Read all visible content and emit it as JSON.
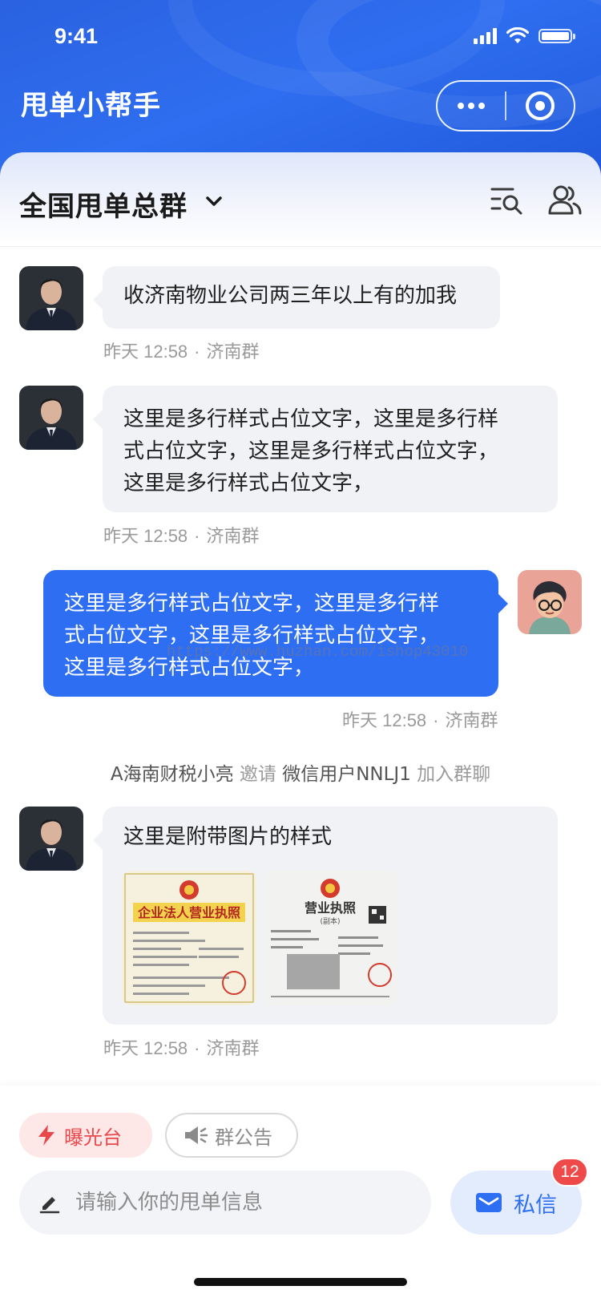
{
  "status_bar": {
    "time": "9:41"
  },
  "header": {
    "app_title": "甩单小帮手"
  },
  "group": {
    "name": "全国甩单总群"
  },
  "messages": [
    {
      "side": "left",
      "text": "收济南物业公司两三年以上有的加我",
      "time": "昨天 12:58",
      "group": "济南群"
    },
    {
      "side": "left",
      "lines": [
        "这里是多行样式占位文字，这里是多行样",
        "式占位文字，这里是多行样式占位文字，",
        "这里是多行样式占位文字，"
      ],
      "time": "昨天 12:58",
      "group": "济南群"
    },
    {
      "side": "right",
      "lines": [
        "这里是多行样式占位文字，这里是多行样",
        "式占位文字，这里是多行样式占位文字，",
        "这里是多行样式占位文字，"
      ],
      "time": "昨天 12:58",
      "group": "济南群"
    },
    {
      "side": "left",
      "text": "这里是附带图片的样式",
      "time": "昨天 12:58",
      "group": "济南群",
      "images": [
        {
          "title": "企业法人营业执照"
        },
        {
          "title": "营业执照",
          "subtitle": "(副本)"
        }
      ]
    }
  ],
  "watermark": "https://www.huzhan.com/ishop43010",
  "system_message": {
    "inviter": "A海南财税小亮",
    "action": "邀请",
    "invitee": "微信用户NNLJ1",
    "suffix": "加入群聊"
  },
  "bottom": {
    "chip_exposure": "曝光台",
    "chip_notice": "群公告",
    "input_placeholder": "请输入你的甩单信息",
    "dm_label": "私信",
    "dm_badge": "12"
  },
  "colors": {
    "primary": "#2d6ef2",
    "header_blue": "#2a62e0",
    "danger": "#ef4a4a",
    "bubble_gray": "#f1f2f6"
  },
  "icons": [
    "signal-icon",
    "wifi-icon",
    "battery-icon",
    "more-icon",
    "close-target-icon",
    "chevron-down-icon",
    "search-list-icon",
    "members-icon",
    "lightning-icon",
    "megaphone-icon",
    "edit-icon",
    "mail-icon"
  ]
}
